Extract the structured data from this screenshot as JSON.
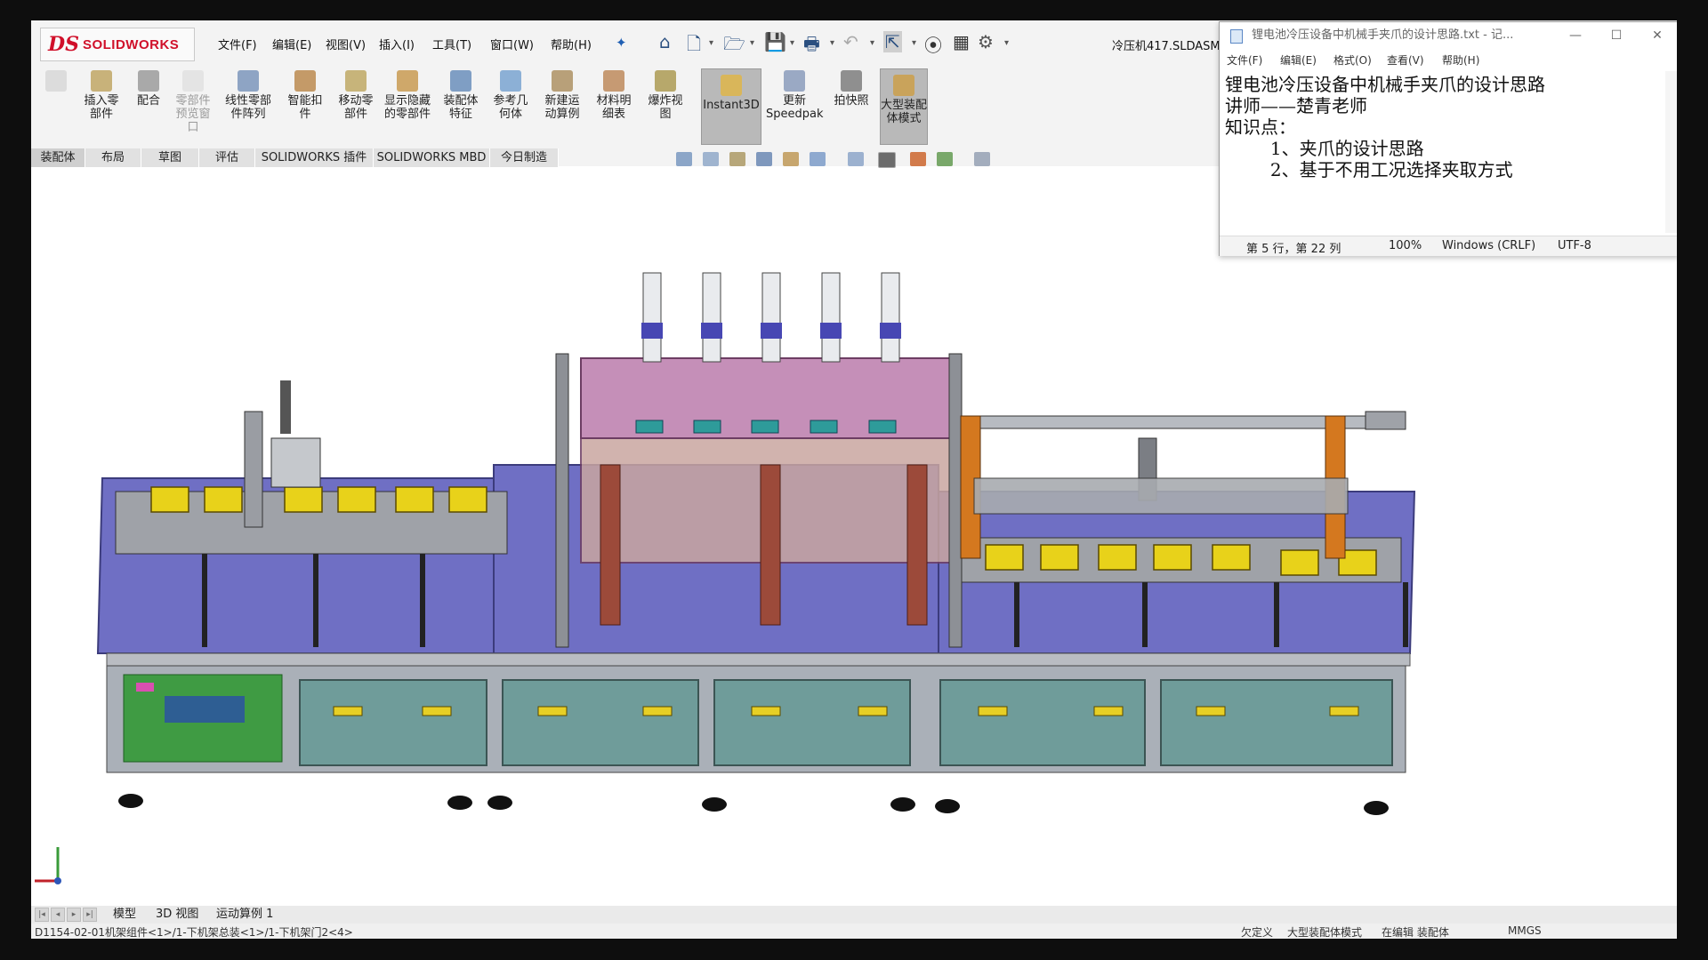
{
  "app": {
    "logo_ds": "DS",
    "logo_text": "SOLIDWORKS",
    "menu": [
      "文件(F)",
      "编辑(E)",
      "视图(V)",
      "插入(I)",
      "工具(T)",
      "窗口(W)",
      "帮助(H)"
    ],
    "document_title": "冷压机417.SLDASM"
  },
  "commands": [
    {
      "label": "插入零部件",
      "disabled": false
    },
    {
      "label": "配合",
      "disabled": false
    },
    {
      "label": "零部件预览窗口",
      "disabled": true
    },
    {
      "label": "线性零部件阵列",
      "disabled": false
    },
    {
      "label": "智能扣件",
      "disabled": false
    },
    {
      "label": "移动零部件",
      "disabled": false
    },
    {
      "label": "显示隐藏的零部件",
      "disabled": false
    },
    {
      "label": "装配体特征",
      "disabled": false
    },
    {
      "label": "参考几何体",
      "disabled": false
    },
    {
      "label": "新建运动算例",
      "disabled": false
    },
    {
      "label": "材料明细表",
      "disabled": false
    },
    {
      "label": "爆炸视图",
      "disabled": false
    },
    {
      "label": "Instant3D",
      "disabled": false,
      "active": true
    },
    {
      "label": "更新 Speedpak",
      "disabled": false
    },
    {
      "label": "拍快照",
      "disabled": false
    },
    {
      "label": "大型装配体模式",
      "disabled": false,
      "active": true
    }
  ],
  "tabs": [
    "装配体",
    "布局",
    "草图",
    "评估",
    "SOLIDWORKS 插件",
    "SOLIDWORKS MBD",
    "今日制造"
  ],
  "notepad": {
    "title": "锂电池冷压设备中机械手夹爪的设计思路.txt - 记...",
    "menu": [
      "文件(F)",
      "编辑(E)",
      "格式(O)",
      "查看(V)",
      "帮助(H)"
    ],
    "lines": [
      "锂电池冷压设备中机械手夹爪的设计思路",
      "讲师——楚青老师",
      "知识点：",
      "        1、夹爪的设计思路",
      "        2、基于不用工况选择夹取方式"
    ],
    "status": {
      "position": "第 5 行，第 22 列",
      "zoom": "100%",
      "eol": "Windows (CRLF)",
      "encoding": "UTF-8"
    }
  },
  "bottom_tabs": [
    "模型",
    "3D 视图",
    "运动算例 1"
  ],
  "status_bar": {
    "path": "D1154-02-01机架组件<1>/1-下机架总装<1>/1-下机架门2<4>",
    "state": "欠定义",
    "mode": "大型装配体模式",
    "editing": "在编辑 装配体",
    "units": "MMGS"
  },
  "colors": {
    "purple_base": "#6f6fc4",
    "yellow_part": "#e8d21a",
    "cabinet": "#6f9c9a",
    "frame_grey": "#9fa2a8",
    "pink_frame": "#c58fb8",
    "rust": "#9c4a3a"
  }
}
